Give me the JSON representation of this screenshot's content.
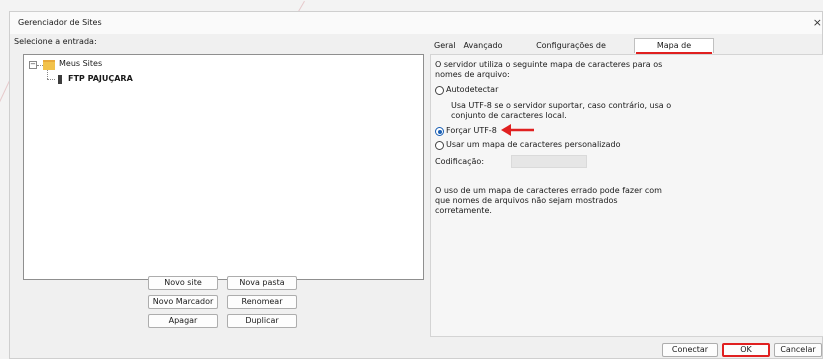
{
  "window": {
    "title": "Gerenciador de Sites",
    "close_glyph": "×"
  },
  "left": {
    "select_label": "Selecione a entrada:",
    "tree": {
      "root": "Meus Sites",
      "root_toggle": "−",
      "child": "FTP PAJUÇARA"
    },
    "buttons": {
      "new_site": "Novo site",
      "new_folder": "Nova pasta",
      "new_bookmark": "Novo Marcador",
      "rename": "Renomear",
      "delete": "Apagar",
      "duplicate": "Duplicar"
    }
  },
  "tabs": [
    "Geral",
    "Avançado",
    "Configurações de transferência",
    "Mapa de caracteres"
  ],
  "charset": {
    "intro": [
      "O servidor utiliza o seguinte mapa de caracteres para os",
      "nomes de arquivo:"
    ],
    "options": {
      "auto": "Autodetectar",
      "auto_desc": [
        "Usa UTF-8 se o servidor suportar, caso contrário, usa o",
        "conjunto de caracteres local."
      ],
      "force_utf8": "Forçar UTF-8",
      "custom": "Usar um mapa de caracteres personalizado"
    },
    "selected": "force_utf8",
    "encoding_label": "Codificação:",
    "encoding_value": "",
    "warning": [
      "O uso de um mapa de caracteres errado pode fazer com",
      "que nomes de arquivos não sejam mostrados",
      "corretamente."
    ]
  },
  "footer": {
    "connect": "Conectar",
    "ok": "OK",
    "cancel": "Cancelar"
  },
  "colors": {
    "annotation_red": "#e02020",
    "radio_blue": "#1a5fb4",
    "folder": "#f2c24b"
  }
}
